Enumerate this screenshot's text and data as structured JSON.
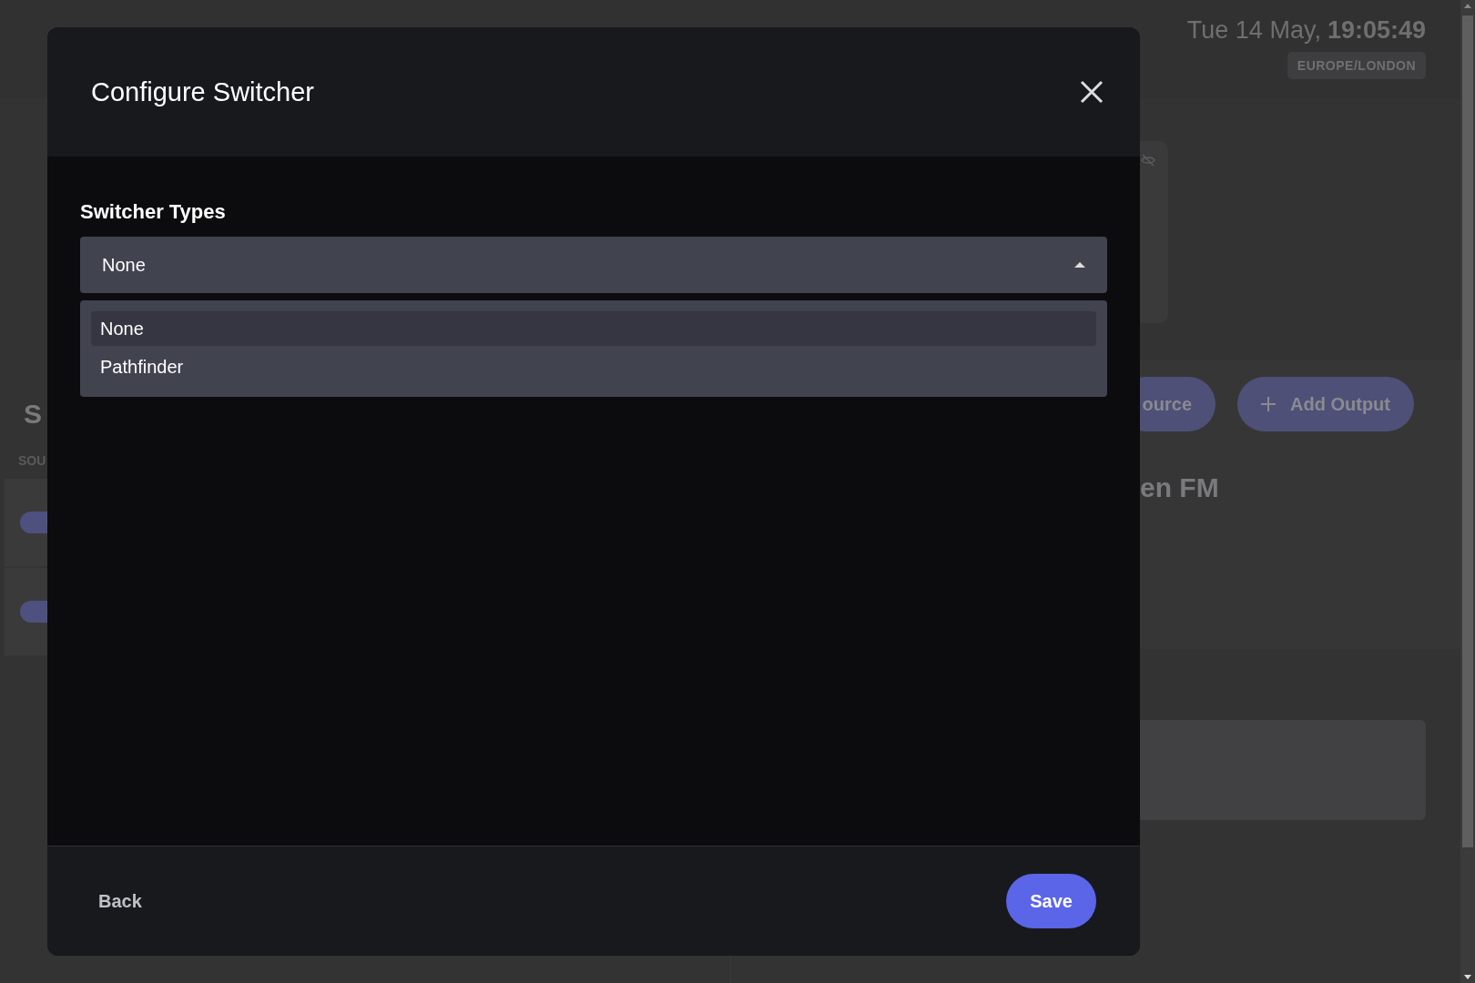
{
  "page": {
    "date": "Tue 14 May,",
    "time": "19:05:49",
    "timezone": "EUROPE/LONDON",
    "section_heading": "S",
    "column_header": "SOU",
    "rows": [
      {
        "on": true
      },
      {
        "on": true
      }
    ],
    "buttons": [
      {
        "label": "ource",
        "icon": false
      },
      {
        "label": "Add Output",
        "icon": true
      }
    ],
    "station_title": "en FM"
  },
  "dialog": {
    "title": "Configure Switcher",
    "field": {
      "label": "Switcher Types",
      "value": "None",
      "expanded": true
    },
    "options": [
      {
        "label": "None",
        "selected": true
      },
      {
        "label": "Pathfinder",
        "selected": false
      }
    ],
    "back": "Back",
    "save": "Save"
  }
}
